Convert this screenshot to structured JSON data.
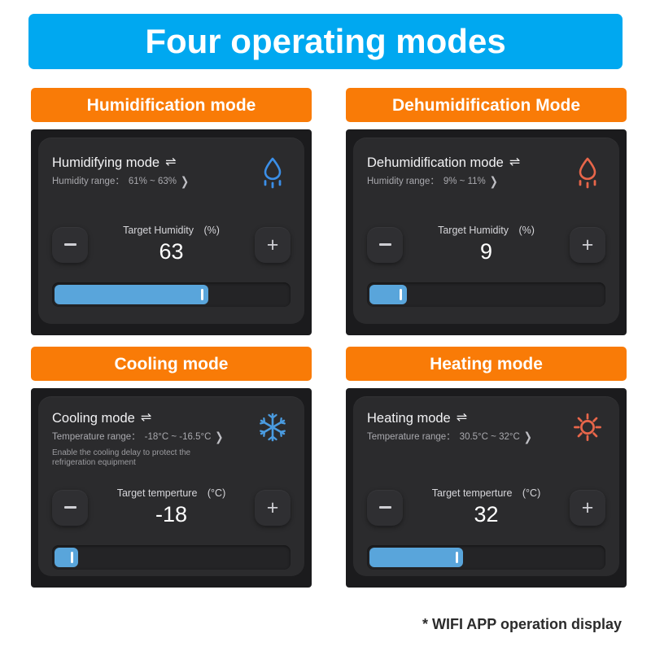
{
  "banner": {
    "title": "Four operating modes",
    "bg_color": "#00A8F0",
    "text_color": "#FFFFFF"
  },
  "theme": {
    "header_orange": "#F97B07",
    "frame_dark": "#1B1B1D",
    "panel_dark": "#2B2B2D",
    "slider_blue": "#59A5DB",
    "icon_blue": "#3B8FE8",
    "icon_orange": "#E8664A"
  },
  "cards": [
    {
      "header_label": "Humidification mode",
      "mode_title": "Humidifying mode",
      "swap_glyph": "⇌",
      "range_label": "Humidity range：",
      "range_value": "61% ~ 63%",
      "chevron": "❯",
      "note": "",
      "target_label": "Target Humidity　(%)",
      "target_value": "63",
      "minus_label": "−",
      "plus_label": "+",
      "slider_percent": 66,
      "icon": "water-drop-icon",
      "icon_color": "#3B8FE8"
    },
    {
      "header_label": "Dehumidification Mode",
      "mode_title": "Dehumidification mode",
      "swap_glyph": "⇌",
      "range_label": "Humidity range：",
      "range_value": "9% ~ 11%",
      "chevron": "❯",
      "note": "",
      "target_label": "Target Humidity　(%)",
      "target_value": "9",
      "minus_label": "−",
      "plus_label": "+",
      "slider_percent": 16,
      "icon": "water-drop-icon",
      "icon_color": "#E8664A"
    },
    {
      "header_label": "Cooling mode",
      "mode_title": "Cooling mode",
      "swap_glyph": "⇌",
      "range_label": "Temperature range：",
      "range_value": "-18°C ~ -16.5°C",
      "chevron": "❯",
      "note": "Enable the cooling delay to protect the refrigeration equipment",
      "target_label": "Target temperture　(°C)",
      "target_value": "-18",
      "minus_label": "−",
      "plus_label": "+",
      "slider_percent": 10,
      "icon": "snowflake-icon",
      "icon_color": "#4A9BE0"
    },
    {
      "header_label": "Heating mode",
      "mode_title": "Heating mode",
      "swap_glyph": "⇌",
      "range_label": "Temperature range：",
      "range_value": "30.5°C ~ 32°C",
      "chevron": "❯",
      "note": "",
      "target_label": "Target temperture　(°C)",
      "target_value": "32",
      "minus_label": "−",
      "plus_label": "+",
      "slider_percent": 40,
      "icon": "sun-icon",
      "icon_color": "#E8664A"
    }
  ],
  "footer": {
    "note": "* WIFI APP operation display"
  }
}
